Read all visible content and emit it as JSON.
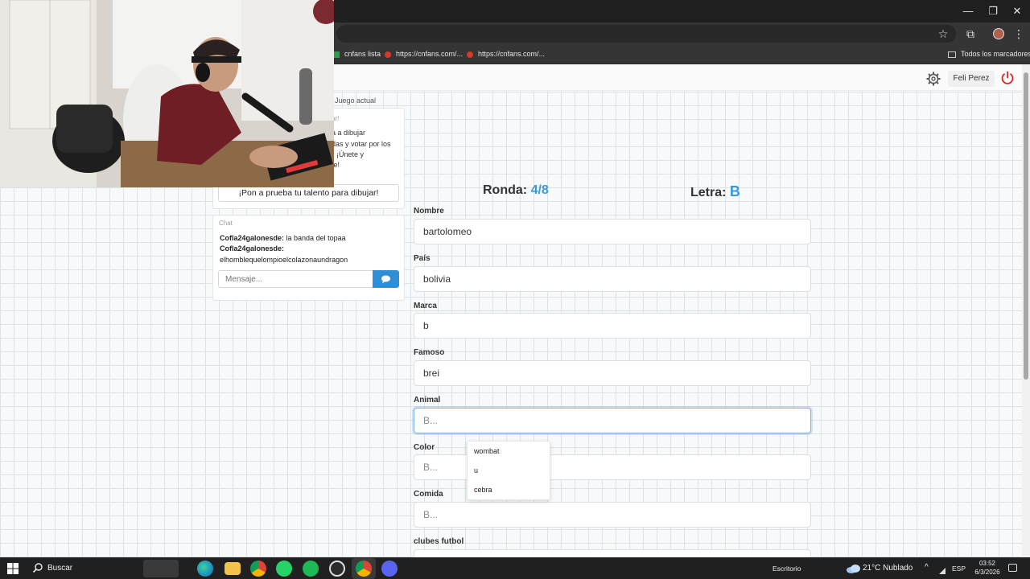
{
  "window": {
    "minimize_glyph": "—",
    "restore_glyph": "❐",
    "close_glyph": "✕"
  },
  "toolbar": {
    "star_icon": "☆",
    "extensions_icon": "⧉",
    "menu_icon": "⋮"
  },
  "bookmarks": {
    "items": [
      {
        "label": "cnfans lista"
      },
      {
        "label": "https://cnfans.com/..."
      },
      {
        "label": "https://cnfans.com/..."
      }
    ],
    "all_bookmarks": "Todos los marcadores"
  },
  "nav": {
    "user_name": "Feli Perez"
  },
  "sidebar": {
    "current_game_label": "Juego actual",
    "invite_partial": [
      "ar!",
      "a a dibujar",
      "das y votar por los",
      "¡Únete y",
      "te!"
    ],
    "test_button": "¡Pon a prueba tu talento para dibujar!",
    "chat_title": "Chat",
    "messages": [
      {
        "user": "Cofla24galonesde:",
        "text": " la banda del topaa"
      },
      {
        "user": "Cofla24galonesde:",
        "text": "elhomblequelompioelcolazonaundragon"
      }
    ],
    "message_placeholder": "Mensaje..."
  },
  "game": {
    "round_label": "Ronda:",
    "round_value": "4/8",
    "letter_label": "Letra:",
    "letter_value": "B",
    "accent": "#3a9ad9",
    "fields": [
      {
        "label": "Nombre",
        "value": "bartolomeo",
        "placeholder": ""
      },
      {
        "label": "País",
        "value": "bolivia",
        "placeholder": ""
      },
      {
        "label": "Marca",
        "value": "b",
        "placeholder": ""
      },
      {
        "label": "Famoso",
        "value": "brei",
        "placeholder": ""
      },
      {
        "label": "Animal",
        "value": "",
        "placeholder": "B..."
      },
      {
        "label": "Color",
        "value": "",
        "placeholder": "B..."
      },
      {
        "label": "Comida",
        "value": "",
        "placeholder": "B..."
      },
      {
        "label": "clubes futbol",
        "value": "",
        "placeholder": ""
      }
    ],
    "autocomplete": [
      "wombat",
      "u",
      "cebra"
    ]
  },
  "taskbar": {
    "search_label": "Buscar",
    "desktop_label": "Escritorio",
    "weather": "21°C  Nublado",
    "language": "ESP",
    "time": "03:52",
    "date": "6/3/2026"
  }
}
